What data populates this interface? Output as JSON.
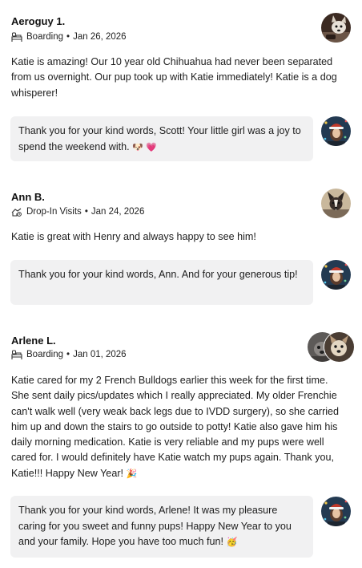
{
  "reviews": [
    {
      "name": "Aeroguy 1.",
      "service": "Boarding",
      "date": "Jan 26, 2026",
      "text": "Katie is amazing! Our 10 year old Chihuahua had never been separated from us overnight. Our pup took up with Katie immediately! Katie is a dog whisperer!",
      "reply": "Thank you for your kind words, Scott! Your little girl was a joy to spend the weekend with.",
      "reply_emoji": "🐶 💗"
    },
    {
      "name": "Ann B.",
      "service": "Drop-In Visits",
      "date": "Jan 24, 2026",
      "text": "Katie is great with Henry and always happy to see him!",
      "reply": "Thank you for your kind words, Ann. And for your generous tip!",
      "reply_emoji": ""
    },
    {
      "name": "Arlene L.",
      "service": "Boarding",
      "date": "Jan 01, 2026",
      "text": "Katie cared for my 2 French Bulldogs earlier this week for the first time. She sent daily pics/updates which I really appreciated. My older Frenchie can't walk well (very weak back legs due to IVDD surgery), so she carried him up and down the stairs to go outside to potty! Katie also gave him his daily morning medication. Katie is very reliable and my pups were well cared for. I would definitely have Katie watch my pups again. Thank you, Katie!!! Happy New Year!",
      "text_emoji": "🎉",
      "reply": "Thank you for your kind words, Arlene! It was my pleasure caring for you sweet and funny pups! Happy New Year to you and your family. Hope you have too much fun!",
      "reply_emoji": "🥳"
    }
  ],
  "separator": "•",
  "icons": {
    "boarding": "boarding-icon",
    "drop_in": "drop-in-icon",
    "sitter_avatar": "sitter-avatar",
    "owner_avatar": "owner-avatar"
  },
  "colors": {
    "reply_bg": "#f1f1f2",
    "text": "#1d1d1d"
  }
}
